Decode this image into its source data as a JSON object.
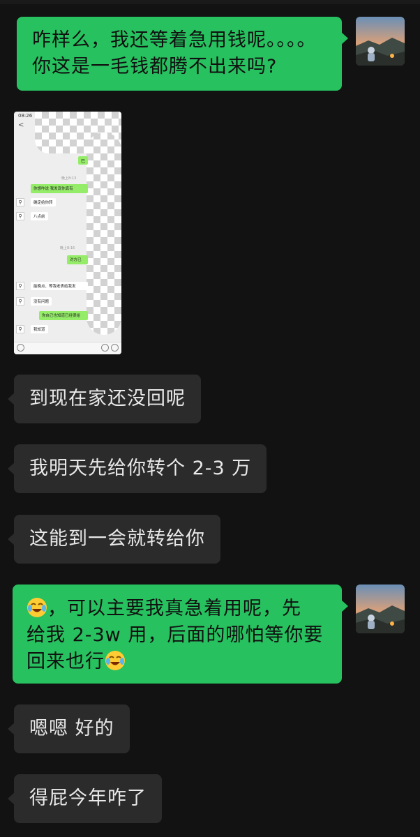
{
  "messages": {
    "m1": "咋样么，我还等着急用钱呢。。。。你这是一毛钱都腾不出来吗?",
    "m1_line1": "咋样么，我还等着急用钱呢。。。。",
    "m1_line2": "你这是一毛钱都腾不出来吗?",
    "m2": "到现在家还没回呢",
    "m3": "我明天先给你转个 2-3 万",
    "m4": "这能到一会就转给你",
    "m5_line1": "，可以主要我真急着用呢，先",
    "m5_line2": "给我 2-3w 用，后面的哪怕等你要",
    "m5_line3": "回来也行",
    "m6": "嗯嗯 好的",
    "m7": "得屁今年咋了"
  },
  "emoji": {
    "m5_icon": "crying-laughing-face"
  },
  "screenshot_thumb": {
    "status_time": "08:26",
    "back_glyph": "<",
    "more_glyph": "···",
    "time_a": "晚上8:13",
    "time_b": "晚上8:16",
    "green_1": "巳",
    "green_2": "你想咋说 我发现你真有",
    "white_1": "确定给你转",
    "white_2": "八点前",
    "green_3": "对方已",
    "white_3": "能晚点、等我老表给我发",
    "white_4": "没有问题",
    "green_4": "你自己也知道已经很给",
    "white_5": "我知道"
  },
  "colors": {
    "outgoing": "#27c15f",
    "incoming": "#2b2b2b",
    "background": "#121212"
  }
}
